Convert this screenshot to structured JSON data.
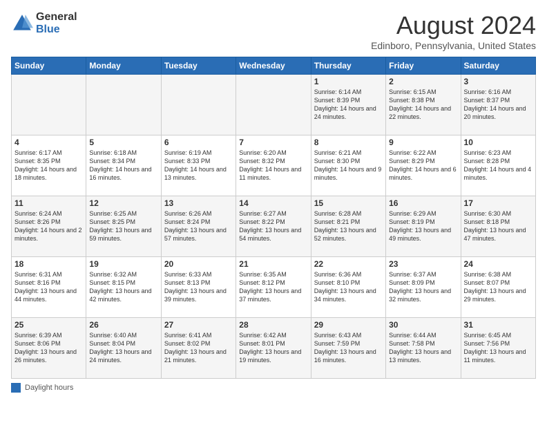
{
  "logo": {
    "general": "General",
    "blue": "Blue"
  },
  "title": "August 2024",
  "location": "Edinboro, Pennsylvania, United States",
  "days_of_week": [
    "Sunday",
    "Monday",
    "Tuesday",
    "Wednesday",
    "Thursday",
    "Friday",
    "Saturday"
  ],
  "legend_label": "Daylight hours",
  "weeks": [
    [
      {
        "day": "",
        "info": ""
      },
      {
        "day": "",
        "info": ""
      },
      {
        "day": "",
        "info": ""
      },
      {
        "day": "",
        "info": ""
      },
      {
        "day": "1",
        "info": "Sunrise: 6:14 AM\nSunset: 8:39 PM\nDaylight: 14 hours\nand 24 minutes."
      },
      {
        "day": "2",
        "info": "Sunrise: 6:15 AM\nSunset: 8:38 PM\nDaylight: 14 hours\nand 22 minutes."
      },
      {
        "day": "3",
        "info": "Sunrise: 6:16 AM\nSunset: 8:37 PM\nDaylight: 14 hours\nand 20 minutes."
      }
    ],
    [
      {
        "day": "4",
        "info": "Sunrise: 6:17 AM\nSunset: 8:35 PM\nDaylight: 14 hours\nand 18 minutes."
      },
      {
        "day": "5",
        "info": "Sunrise: 6:18 AM\nSunset: 8:34 PM\nDaylight: 14 hours\nand 16 minutes."
      },
      {
        "day": "6",
        "info": "Sunrise: 6:19 AM\nSunset: 8:33 PM\nDaylight: 14 hours\nand 13 minutes."
      },
      {
        "day": "7",
        "info": "Sunrise: 6:20 AM\nSunset: 8:32 PM\nDaylight: 14 hours\nand 11 minutes."
      },
      {
        "day": "8",
        "info": "Sunrise: 6:21 AM\nSunset: 8:30 PM\nDaylight: 14 hours\nand 9 minutes."
      },
      {
        "day": "9",
        "info": "Sunrise: 6:22 AM\nSunset: 8:29 PM\nDaylight: 14 hours\nand 6 minutes."
      },
      {
        "day": "10",
        "info": "Sunrise: 6:23 AM\nSunset: 8:28 PM\nDaylight: 14 hours\nand 4 minutes."
      }
    ],
    [
      {
        "day": "11",
        "info": "Sunrise: 6:24 AM\nSunset: 8:26 PM\nDaylight: 14 hours\nand 2 minutes."
      },
      {
        "day": "12",
        "info": "Sunrise: 6:25 AM\nSunset: 8:25 PM\nDaylight: 13 hours\nand 59 minutes."
      },
      {
        "day": "13",
        "info": "Sunrise: 6:26 AM\nSunset: 8:24 PM\nDaylight: 13 hours\nand 57 minutes."
      },
      {
        "day": "14",
        "info": "Sunrise: 6:27 AM\nSunset: 8:22 PM\nDaylight: 13 hours\nand 54 minutes."
      },
      {
        "day": "15",
        "info": "Sunrise: 6:28 AM\nSunset: 8:21 PM\nDaylight: 13 hours\nand 52 minutes."
      },
      {
        "day": "16",
        "info": "Sunrise: 6:29 AM\nSunset: 8:19 PM\nDaylight: 13 hours\nand 49 minutes."
      },
      {
        "day": "17",
        "info": "Sunrise: 6:30 AM\nSunset: 8:18 PM\nDaylight: 13 hours\nand 47 minutes."
      }
    ],
    [
      {
        "day": "18",
        "info": "Sunrise: 6:31 AM\nSunset: 8:16 PM\nDaylight: 13 hours\nand 44 minutes."
      },
      {
        "day": "19",
        "info": "Sunrise: 6:32 AM\nSunset: 8:15 PM\nDaylight: 13 hours\nand 42 minutes."
      },
      {
        "day": "20",
        "info": "Sunrise: 6:33 AM\nSunset: 8:13 PM\nDaylight: 13 hours\nand 39 minutes."
      },
      {
        "day": "21",
        "info": "Sunrise: 6:35 AM\nSunset: 8:12 PM\nDaylight: 13 hours\nand 37 minutes."
      },
      {
        "day": "22",
        "info": "Sunrise: 6:36 AM\nSunset: 8:10 PM\nDaylight: 13 hours\nand 34 minutes."
      },
      {
        "day": "23",
        "info": "Sunrise: 6:37 AM\nSunset: 8:09 PM\nDaylight: 13 hours\nand 32 minutes."
      },
      {
        "day": "24",
        "info": "Sunrise: 6:38 AM\nSunset: 8:07 PM\nDaylight: 13 hours\nand 29 minutes."
      }
    ],
    [
      {
        "day": "25",
        "info": "Sunrise: 6:39 AM\nSunset: 8:06 PM\nDaylight: 13 hours\nand 26 minutes."
      },
      {
        "day": "26",
        "info": "Sunrise: 6:40 AM\nSunset: 8:04 PM\nDaylight: 13 hours\nand 24 minutes."
      },
      {
        "day": "27",
        "info": "Sunrise: 6:41 AM\nSunset: 8:02 PM\nDaylight: 13 hours\nand 21 minutes."
      },
      {
        "day": "28",
        "info": "Sunrise: 6:42 AM\nSunset: 8:01 PM\nDaylight: 13 hours\nand 19 minutes."
      },
      {
        "day": "29",
        "info": "Sunrise: 6:43 AM\nSunset: 7:59 PM\nDaylight: 13 hours\nand 16 minutes."
      },
      {
        "day": "30",
        "info": "Sunrise: 6:44 AM\nSunset: 7:58 PM\nDaylight: 13 hours\nand 13 minutes."
      },
      {
        "day": "31",
        "info": "Sunrise: 6:45 AM\nSunset: 7:56 PM\nDaylight: 13 hours\nand 11 minutes."
      }
    ]
  ]
}
